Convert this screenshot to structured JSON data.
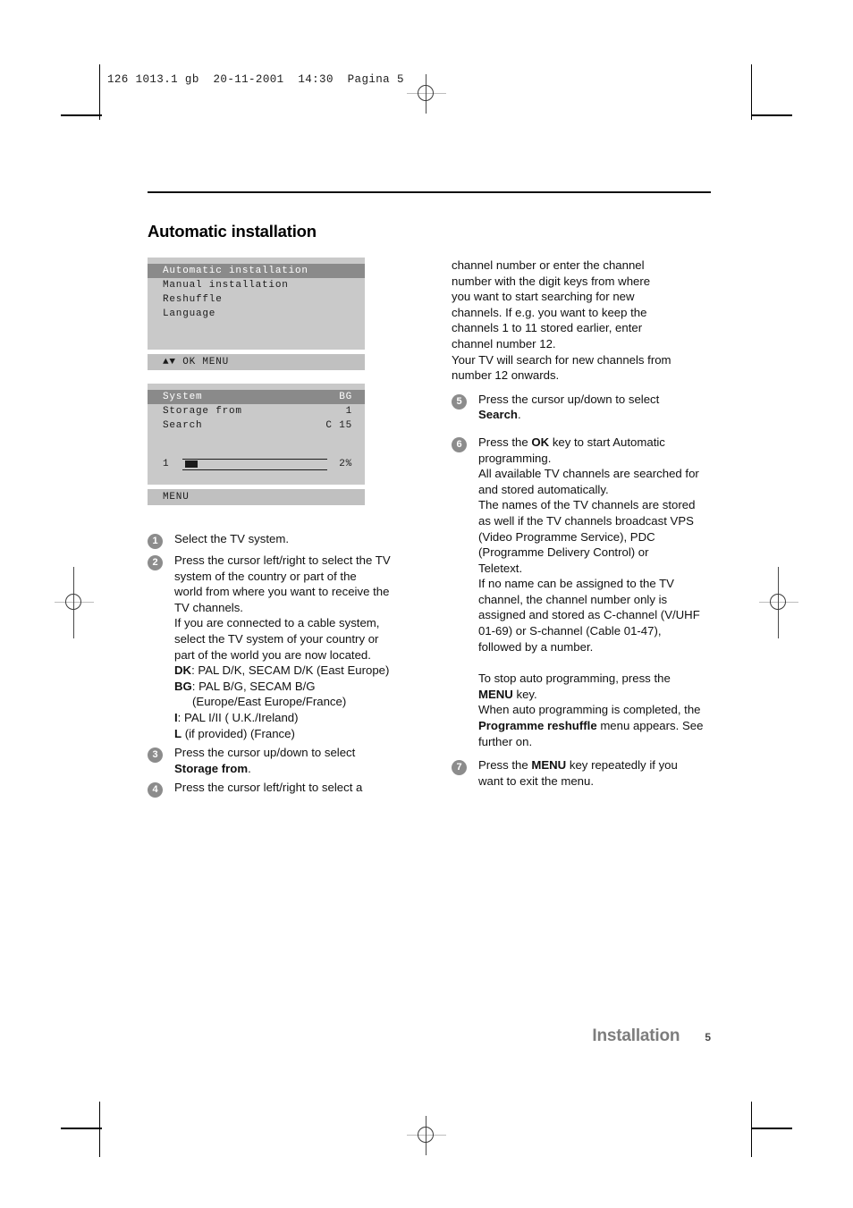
{
  "printer_header": {
    "text": "126 1013.1 gb  20-11-2001  14:30  Pagina 5"
  },
  "document": {
    "title": "Automatic installation",
    "footer_title": "Installation",
    "page_number": "5"
  },
  "osd_menu_1": {
    "items": [
      {
        "label": "Automatic installation",
        "selected": true
      },
      {
        "label": "Manual installation",
        "selected": false
      },
      {
        "label": "Reshuffle",
        "selected": false
      },
      {
        "label": "Language",
        "selected": false
      }
    ],
    "status_bar": "▲▼ OK MENU"
  },
  "osd_menu_2": {
    "rows": [
      {
        "label": "System",
        "value": "BG",
        "selected": true
      },
      {
        "label": "Storage from",
        "value": "1",
        "selected": false
      },
      {
        "label": "Search",
        "value": "C 15",
        "selected": false
      }
    ],
    "progress": {
      "channel": "1",
      "percent_label": "2%",
      "percent_value": 2
    },
    "status_bar": "MENU"
  },
  "steps_left": [
    {
      "number": "1",
      "lines": [
        {
          "text": "Select the TV system."
        }
      ]
    },
    {
      "number": "2",
      "lines": [
        {
          "text": "Press the cursor left/right to select the TV"
        },
        {
          "text": "system of the country or part of the"
        },
        {
          "text": "world from where you want to receive the"
        },
        {
          "text": "TV channels."
        },
        {
          "text": "If you are connected to a cable system,"
        },
        {
          "text": "select the TV system of your country or"
        },
        {
          "text": "part of the world you are now located."
        }
      ],
      "systems": [
        {
          "code": "DK",
          "sep": ": ",
          "desc": "PAL D/K, SECAM D/K (East Europe)"
        },
        {
          "code": "BG",
          "sep": ": ",
          "desc": "PAL B/G, SECAM B/G"
        },
        {
          "code": "",
          "sep": "",
          "desc": "(Europe/East Europe/France)",
          "indent": true
        },
        {
          "code": "I",
          "sep": ": ",
          "desc": "PAL I/II ( U.K./Ireland)"
        },
        {
          "code": "L",
          "sep": " ",
          "desc": "(if provided) (France)"
        }
      ]
    },
    {
      "number": "3",
      "lines": [
        {
          "text": "Press the cursor up/down to select"
        },
        {
          "text": "Storage from",
          "bold": true,
          "suffix": "."
        }
      ]
    },
    {
      "number": "4",
      "lines": [
        {
          "text": "Press the cursor left/right to select a"
        }
      ]
    }
  ],
  "right_column": {
    "continuation": [
      "channel number or enter the channel",
      "number with the digit keys from where",
      "you want to start searching for new",
      "channels. If e.g. you want to keep the",
      "channels 1 to 11 stored earlier, enter",
      "channel number 12.",
      "Your TV will search for new channels from",
      "number 12 onwards."
    ],
    "step5": {
      "number": "5",
      "line1": "Press the cursor up/down to select",
      "bold_term": "Search",
      "after_bold": "."
    },
    "step6": {
      "number": "6",
      "l1_pre": "Press the ",
      "l1_bold": "OK",
      "l1_post": " key to start Automatic",
      "l2": "programming.",
      "l3": "All available TV channels are searched for",
      "l4": "and stored automatically.",
      "l5": "The names of the TV channels are stored",
      "l6": "as well if the TV channels broadcast VPS",
      "l7": "(Video Programme Service), PDC",
      "l8": "(Programme Delivery Control) or",
      "l9": "Teletext.",
      "l10": "If no name can be assigned to the TV",
      "l11": "channel, the channel number only is",
      "l12": "assigned and stored as C-channel (V/UHF",
      "l13": "01-69) or S-channel (Cable 01-47),",
      "l14": "followed by a number."
    },
    "stop_note": {
      "l1": "To stop auto programming, press the",
      "l2_bold": "MENU",
      "l2_post": " key.",
      "l3": "When auto programming is completed, the",
      "l4_bold": "Programme reshuffle",
      "l4_post": " menu appears. See",
      "l5": "further on."
    },
    "step7": {
      "number": "7",
      "l1_pre": "Press the ",
      "l1_bold": "MENU",
      "l1_post": " key repeatedly if you",
      "l2": "want to exit the menu."
    }
  }
}
